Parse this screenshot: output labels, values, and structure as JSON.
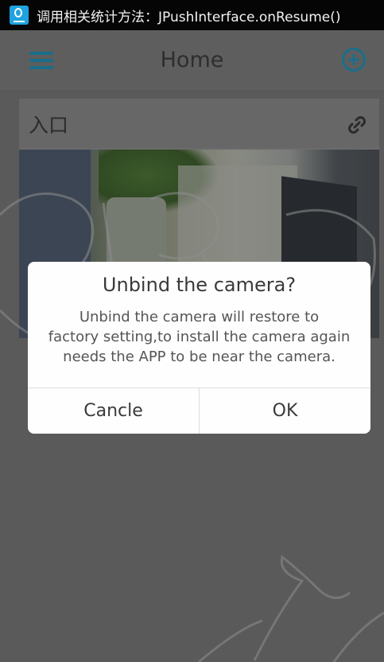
{
  "status_bar": {
    "icon": "notification-icon",
    "text": "调用相关统计方法：JPushInterface.onResume()"
  },
  "header": {
    "title": "Home",
    "menu_icon": "hamburger-menu-icon",
    "add_icon": "add-circle-icon"
  },
  "card": {
    "title": "入口",
    "link_icon": "link-icon"
  },
  "dialog": {
    "title": "Unbind the camera?",
    "message_lines": [
      "Unbind the camera will restore to",
      "factory setting,to install the camera again",
      "needs the APP to be near the camera."
    ],
    "cancel_label": "Cancle",
    "ok_label": "OK"
  },
  "colors": {
    "accent": "#1a6e8a",
    "overlay_bg": "#5a5a5a",
    "dialog_bg": "#fefefe"
  }
}
